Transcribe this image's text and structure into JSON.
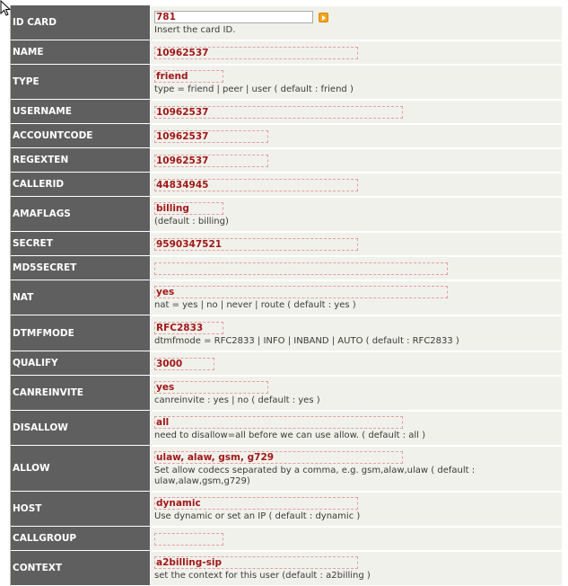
{
  "fields": {
    "id_card": {
      "label": "ID CARD",
      "value": "781",
      "description": "Insert the card ID."
    },
    "name": {
      "label": "NAME",
      "value": "10962537"
    },
    "type": {
      "label": "TYPE",
      "value": "friend",
      "description": "type = friend | peer | user ( default : friend )"
    },
    "username": {
      "label": "USERNAME",
      "value": "10962537"
    },
    "accountcode": {
      "label": "ACCOUNTCODE",
      "value": "10962537"
    },
    "regexten": {
      "label": "REGEXTEN",
      "value": "10962537"
    },
    "callerid": {
      "label": "CALLERID",
      "value": "44834945"
    },
    "amaflags": {
      "label": "AMAFLAGS",
      "value": "billing",
      "description": "(default : billing)"
    },
    "secret": {
      "label": "SECRET",
      "value": "9590347521"
    },
    "md5secret": {
      "label": "MD5SECRET",
      "value": ""
    },
    "nat": {
      "label": "NAT",
      "value": "yes",
      "description": "nat = yes | no | never | route ( default : yes )"
    },
    "dtmfmode": {
      "label": "DTMFMODE",
      "value": "RFC2833",
      "description": "dtmfmode = RFC2833 | INFO | INBAND | AUTO ( default : RFC2833 )"
    },
    "qualify": {
      "label": "QUALIFY",
      "value": "3000"
    },
    "canreinvite": {
      "label": "CANREINVITE",
      "value": "yes",
      "description": "canreinvite : yes | no ( default : yes )"
    },
    "disallow": {
      "label": "DISALLOW",
      "value": "all",
      "description": "need to disallow=all before we can use allow. ( default : all )"
    },
    "allow": {
      "label": "ALLOW",
      "value": "ulaw, alaw, gsm, g729",
      "description": "Set allow codecs separated by a comma, e.g. gsm,alaw,ulaw ( default : ulaw,alaw,gsm,g729)"
    },
    "host": {
      "label": "HOST",
      "value": "dynamic",
      "description": "Use dynamic or set an IP ( default : dynamic )"
    },
    "callgroup": {
      "label": "CALLGROUP",
      "value": ""
    },
    "context": {
      "label": "CONTEXT",
      "value": "a2billing-sip",
      "description": "set the context for this user (default : a2billing )"
    }
  },
  "icons": {
    "go_button": "arrow-right-icon",
    "cursor": "mouse-pointer-icon"
  },
  "colors": {
    "label_bg": "#5f5f5f",
    "value_bg": "#f1f1ec",
    "value_text": "#a11818",
    "field_border": "#e0a0a0",
    "button": "#f2a51e"
  }
}
